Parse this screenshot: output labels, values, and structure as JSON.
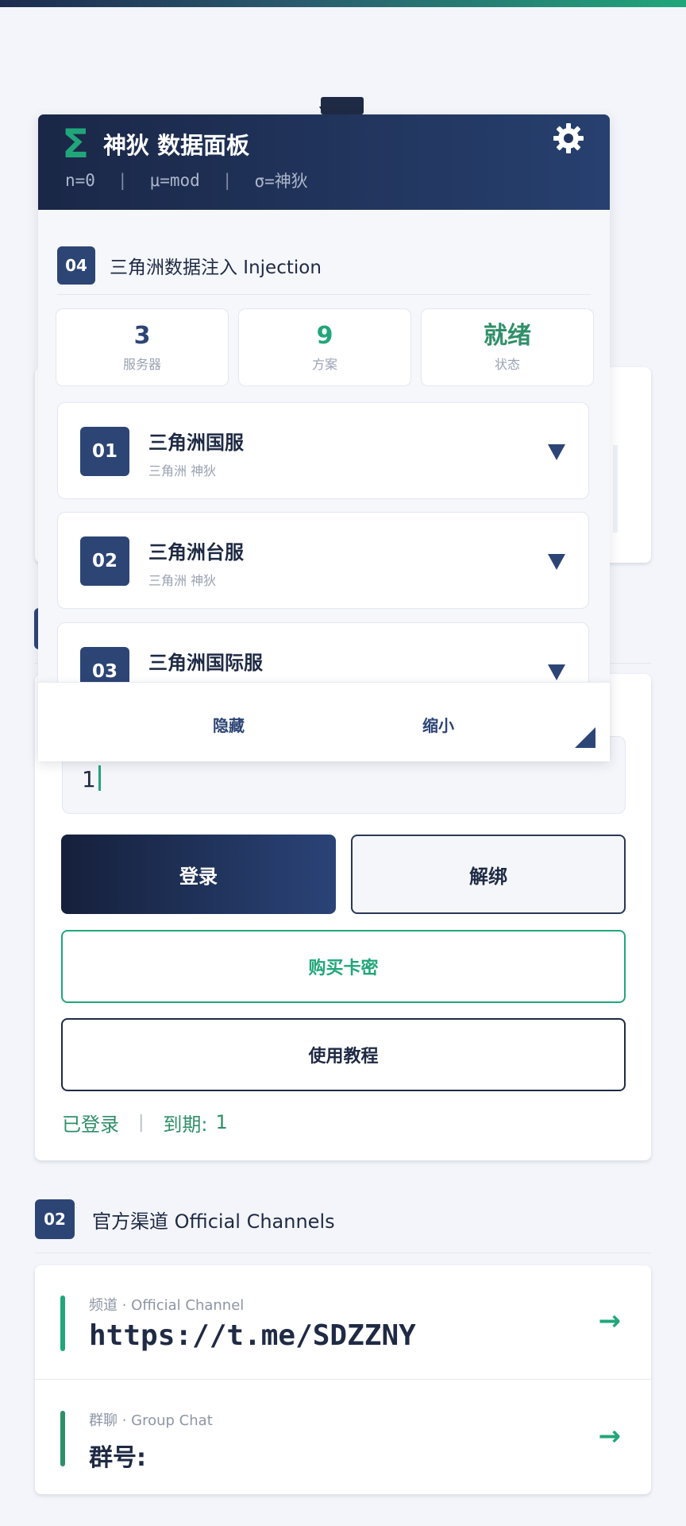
{
  "panel": {
    "title": "神狄 数据面板",
    "params": [
      "n=0",
      "μ=mod",
      "σ=神狄"
    ],
    "section": {
      "number": "04",
      "title": "三角洲数据注入 Injection"
    },
    "stats": [
      {
        "value": "3",
        "label": "服务器",
        "color": "#2d4575"
      },
      {
        "value": "9",
        "label": "方案",
        "color": "#21a67a"
      },
      {
        "value": "就绪",
        "label": "状态",
        "color": "#2f8f68"
      }
    ],
    "servers": [
      {
        "number": "01",
        "name": "三角洲国服",
        "subtitle": "三角洲 神狄"
      },
      {
        "number": "02",
        "name": "三角洲台服",
        "subtitle": "三角洲 神狄"
      },
      {
        "number": "03",
        "name": "三角洲国际服"
      }
    ],
    "footer": {
      "hide_label": "隐藏",
      "shrink_label": "缩小"
    }
  },
  "login": {
    "input_value": "1",
    "login_label": "登录",
    "unbind_label": "解绑",
    "buy_label": "购买卡密",
    "tutorial_label": "使用教程",
    "status_text": "已登录",
    "expiry_label": "到期:",
    "expiry_value": "1"
  },
  "channels": {
    "section": {
      "number": "02",
      "title": "官方渠道 Official Channels"
    },
    "items": [
      {
        "label": "频道 · Official Channel",
        "value": "https://t.me/SDZZNY"
      },
      {
        "label": "群聊 · Group Chat",
        "value": "群号:"
      }
    ]
  },
  "colors": {
    "navy": "#2d4575",
    "accent_green": "#21a67a",
    "text_dark": "#1f2a44"
  },
  "icons": [
    "sigma-icon",
    "gear-icon",
    "caret-down-icon",
    "arrow-right-icon",
    "resize-handle-icon"
  ]
}
